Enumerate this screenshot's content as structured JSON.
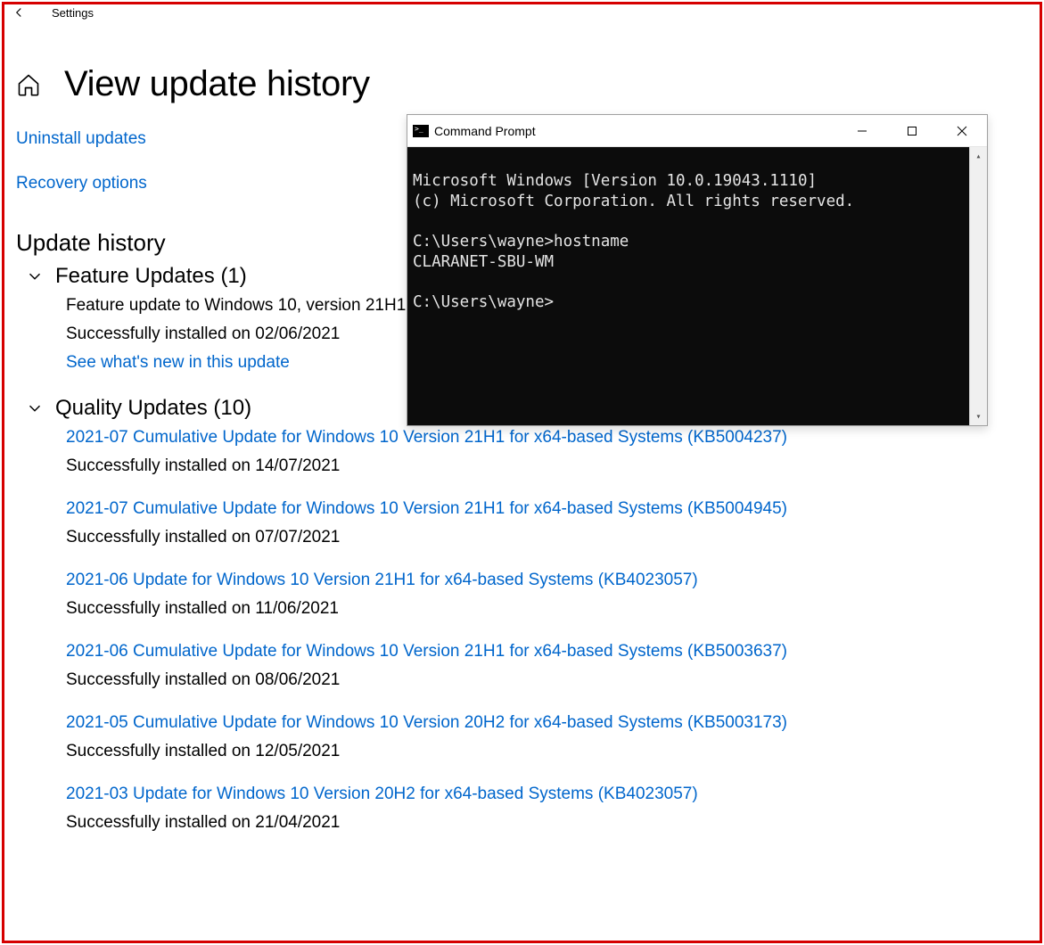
{
  "topbar": {
    "title": "Settings"
  },
  "page": {
    "title": "View update history",
    "links": {
      "uninstall": "Uninstall updates",
      "recovery": "Recovery options"
    },
    "history_heading": "Update history",
    "feature_group_label": "Feature Updates (1)",
    "feature_items": [
      {
        "title": "Feature update to Windows 10, version 21H1",
        "status": "Successfully installed on 02/06/2021",
        "sublink": "See what's new in this update"
      }
    ],
    "quality_group_label": "Quality Updates (10)",
    "quality_items": [
      {
        "title": "2021-07 Cumulative Update for Windows 10 Version 21H1 for x64-based Systems (KB5004237)",
        "status": "Successfully installed on 14/07/2021"
      },
      {
        "title": "2021-07 Cumulative Update for Windows 10 Version 21H1 for x64-based Systems (KB5004945)",
        "status": "Successfully installed on 07/07/2021"
      },
      {
        "title": "2021-06 Update for Windows 10 Version 21H1 for x64-based Systems (KB4023057)",
        "status": "Successfully installed on 11/06/2021"
      },
      {
        "title": "2021-06 Cumulative Update for Windows 10 Version 21H1 for x64-based Systems (KB5003637)",
        "status": "Successfully installed on 08/06/2021"
      },
      {
        "title": "2021-05 Cumulative Update for Windows 10 Version 20H2 for x64-based Systems (KB5003173)",
        "status": "Successfully installed on 12/05/2021"
      },
      {
        "title": "2021-03 Update for Windows 10 Version 20H2 for x64-based Systems (KB4023057)",
        "status": "Successfully installed on 21/04/2021"
      }
    ]
  },
  "cmd": {
    "title": "Command Prompt",
    "lines": [
      "Microsoft Windows [Version 10.0.19043.1110]",
      "(c) Microsoft Corporation. All rights reserved.",
      "",
      "C:\\Users\\wayne>hostname",
      "CLARANET-SBU-WM",
      "",
      "C:\\Users\\wayne>"
    ]
  }
}
